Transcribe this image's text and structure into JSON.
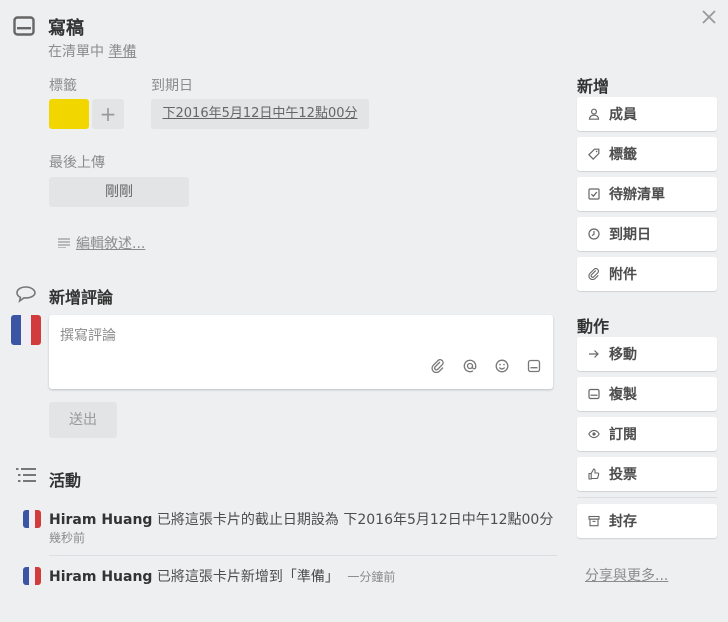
{
  "card": {
    "title": "寫稿",
    "list_prefix": "在清單中",
    "list_name": "準備"
  },
  "labels": {
    "heading": "標籤",
    "add_label": "+",
    "color": "#f2d600"
  },
  "due": {
    "heading": "到期日",
    "value": "下2016年5月12日中午12點00分"
  },
  "upload": {
    "heading": "最後上傳",
    "value": "剛剛"
  },
  "description": {
    "edit_label": "編輯敘述..."
  },
  "comment": {
    "heading": "新增評論",
    "placeholder": "撰寫評論",
    "send_label": "送出"
  },
  "activity": {
    "heading": "活動",
    "items": [
      {
        "user": "Hiram Huang",
        "text": "已將這張卡片的截止日期設為 下2016年5月12日中午12點00分",
        "time": "幾秒前"
      },
      {
        "user": "Hiram Huang",
        "text": "已將這張卡片新增到「準備」",
        "time": "一分鐘前"
      }
    ]
  },
  "sidebar": {
    "add_heading": "新增",
    "add_items": [
      {
        "label": "成員",
        "icon": "person-icon"
      },
      {
        "label": "標籤",
        "icon": "tag-icon"
      },
      {
        "label": "待辦清單",
        "icon": "checklist-icon"
      },
      {
        "label": "到期日",
        "icon": "clock-icon"
      },
      {
        "label": "附件",
        "icon": "paperclip-icon"
      }
    ],
    "actions_heading": "動作",
    "action_items": [
      {
        "label": "移動",
        "icon": "arrow-right-icon"
      },
      {
        "label": "複製",
        "icon": "card-icon"
      },
      {
        "label": "訂閱",
        "icon": "eye-icon"
      },
      {
        "label": "投票",
        "icon": "thumbs-up-icon"
      }
    ],
    "archive": {
      "label": "封存",
      "icon": "archive-icon"
    },
    "share_label": "分享與更多..."
  }
}
